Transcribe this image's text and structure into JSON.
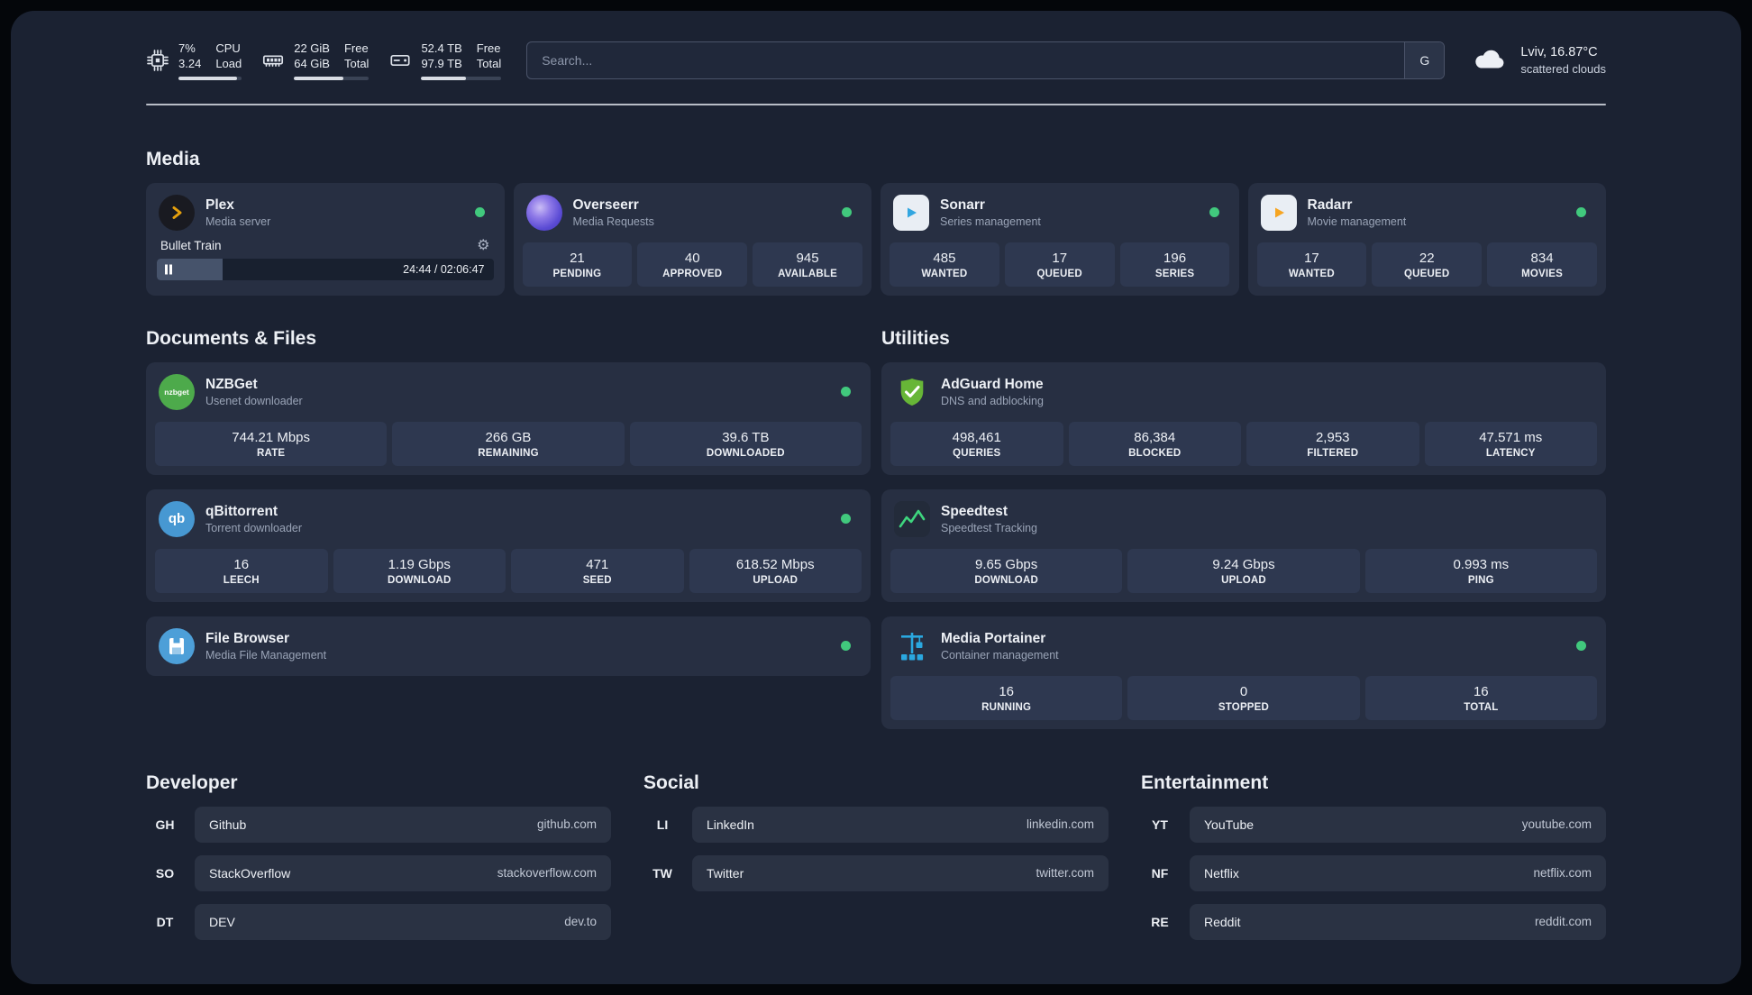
{
  "colors": {
    "bg": "#1b2232",
    "card": "#272f42",
    "stat": "#2e3850",
    "pill": "#2a3243",
    "status-green": "#41c97d"
  },
  "topbar": {
    "cpu": {
      "value": "7%",
      "sub": "3.24",
      "label_top": "CPU",
      "label_bottom": "Load",
      "bar_pct": 92
    },
    "ram": {
      "value": "22 GiB",
      "sub": "64 GiB",
      "label_top": "Free",
      "label_bottom": "Total",
      "bar_pct": 66
    },
    "disk": {
      "value": "52.4 TB",
      "sub": "97.9 TB",
      "label_top": "Free",
      "label_bottom": "Total",
      "bar_pct": 56
    },
    "search": {
      "placeholder": "Search...",
      "engine": "G"
    },
    "weather": {
      "location": "Lviv, 16.87°C",
      "condition": "scattered clouds"
    }
  },
  "media": {
    "title": "Media",
    "cards": [
      {
        "name": "Plex",
        "subtitle": "Media server",
        "online": true,
        "now_playing": {
          "title": "Bullet Train",
          "time": "24:44 / 02:06:47",
          "progress_pct": 19.5
        }
      },
      {
        "name": "Overseerr",
        "subtitle": "Media Requests",
        "online": true,
        "stats": [
          {
            "value": "21",
            "label": "PENDING"
          },
          {
            "value": "40",
            "label": "APPROVED"
          },
          {
            "value": "945",
            "label": "AVAILABLE"
          }
        ]
      },
      {
        "name": "Sonarr",
        "subtitle": "Series management",
        "online": true,
        "stats": [
          {
            "value": "485",
            "label": "WANTED"
          },
          {
            "value": "17",
            "label": "QUEUED"
          },
          {
            "value": "196",
            "label": "SERIES"
          }
        ]
      },
      {
        "name": "Radarr",
        "subtitle": "Movie management",
        "online": true,
        "stats": [
          {
            "value": "17",
            "label": "WANTED"
          },
          {
            "value": "22",
            "label": "QUEUED"
          },
          {
            "value": "834",
            "label": "MOVIES"
          }
        ]
      }
    ]
  },
  "documents": {
    "title": "Documents & Files",
    "cards": [
      {
        "name": "NZBGet",
        "subtitle": "Usenet downloader",
        "icon_text": "nzbget",
        "online": true,
        "stats": [
          {
            "value": "744.21 Mbps",
            "label": "RATE"
          },
          {
            "value": "266 GB",
            "label": "REMAINING"
          },
          {
            "value": "39.6 TB",
            "label": "DOWNLOADED"
          }
        ]
      },
      {
        "name": "qBittorrent",
        "subtitle": "Torrent downloader",
        "icon_text": "qb",
        "online": true,
        "stats": [
          {
            "value": "16",
            "label": "LEECH"
          },
          {
            "value": "1.19 Gbps",
            "label": "DOWNLOAD"
          },
          {
            "value": "471",
            "label": "SEED"
          },
          {
            "value": "618.52 Mbps",
            "label": "UPLOAD"
          }
        ]
      },
      {
        "name": "File Browser",
        "subtitle": "Media File Management",
        "online": true,
        "stats": []
      }
    ]
  },
  "utilities": {
    "title": "Utilities",
    "cards": [
      {
        "name": "AdGuard Home",
        "subtitle": "DNS and adblocking",
        "stats": [
          {
            "value": "498,461",
            "label": "QUERIES"
          },
          {
            "value": "86,384",
            "label": "BLOCKED"
          },
          {
            "value": "2,953",
            "label": "FILTERED"
          },
          {
            "value": "47.571 ms",
            "label": "LATENCY"
          }
        ]
      },
      {
        "name": "Speedtest",
        "subtitle": "Speedtest Tracking",
        "stats": [
          {
            "value": "9.65 Gbps",
            "label": "DOWNLOAD"
          },
          {
            "value": "9.24 Gbps",
            "label": "UPLOAD"
          },
          {
            "value": "0.993 ms",
            "label": "PING"
          }
        ]
      },
      {
        "name": "Media Portainer",
        "subtitle": "Container management",
        "online": true,
        "stats": [
          {
            "value": "16",
            "label": "RUNNING"
          },
          {
            "value": "0",
            "label": "STOPPED"
          },
          {
            "value": "16",
            "label": "TOTAL"
          }
        ]
      }
    ]
  },
  "bookmarks": [
    {
      "title": "Developer",
      "items": [
        {
          "abbr": "GH",
          "name": "Github",
          "url": "github.com"
        },
        {
          "abbr": "SO",
          "name": "StackOverflow",
          "url": "stackoverflow.com"
        },
        {
          "abbr": "DT",
          "name": "DEV",
          "url": "dev.to"
        }
      ]
    },
    {
      "title": "Social",
      "items": [
        {
          "abbr": "LI",
          "name": "LinkedIn",
          "url": "linkedin.com"
        },
        {
          "abbr": "TW",
          "name": "Twitter",
          "url": "twitter.com"
        }
      ]
    },
    {
      "title": "Entertainment",
      "items": [
        {
          "abbr": "YT",
          "name": "YouTube",
          "url": "youtube.com"
        },
        {
          "abbr": "NF",
          "name": "Netflix",
          "url": "netflix.com"
        },
        {
          "abbr": "RE",
          "name": "Reddit",
          "url": "reddit.com"
        }
      ]
    }
  ]
}
